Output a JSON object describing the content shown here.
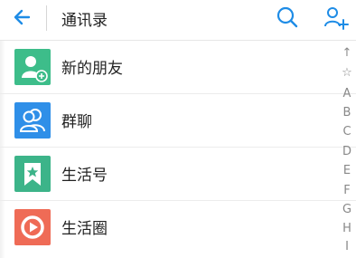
{
  "header": {
    "title": "通讯录",
    "back_icon": "back-arrow-icon",
    "search_icon": "search-icon",
    "add_user_icon": "add-user-icon"
  },
  "colors": {
    "accent": "#1e8ce6",
    "new_friends_bg": "#3dbd8a",
    "group_chat_bg": "#2f8fe8",
    "service_bg": "#3cb489",
    "moments_bg": "#ef6b56"
  },
  "list": {
    "items": [
      {
        "label": "新的朋友",
        "icon": "add-contact-icon"
      },
      {
        "label": "群聊",
        "icon": "group-chat-icon"
      },
      {
        "label": "生活号",
        "icon": "bookmark-star-icon"
      },
      {
        "label": "生活圈",
        "icon": "play-circle-icon"
      }
    ]
  },
  "index": {
    "items": [
      "↑",
      "☆",
      "A",
      "B",
      "C",
      "D",
      "E",
      "F",
      "G",
      "H",
      "I"
    ]
  }
}
